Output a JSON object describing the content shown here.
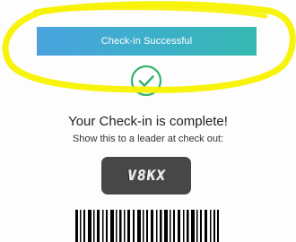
{
  "banner": {
    "label": "Check-in Successful",
    "gradient_start": "#4aa3df",
    "gradient_end": "#35b8b0"
  },
  "status_icon": {
    "name": "check-circle-icon",
    "color": "#35b46a"
  },
  "message": {
    "title": "Your Check-in is complete!",
    "subtitle": "Show this to a leader at check out:"
  },
  "security_code": {
    "value": "V8KX"
  },
  "barcode": {
    "name": "barcode-icon"
  },
  "annotation": {
    "color": "#f7f200"
  }
}
